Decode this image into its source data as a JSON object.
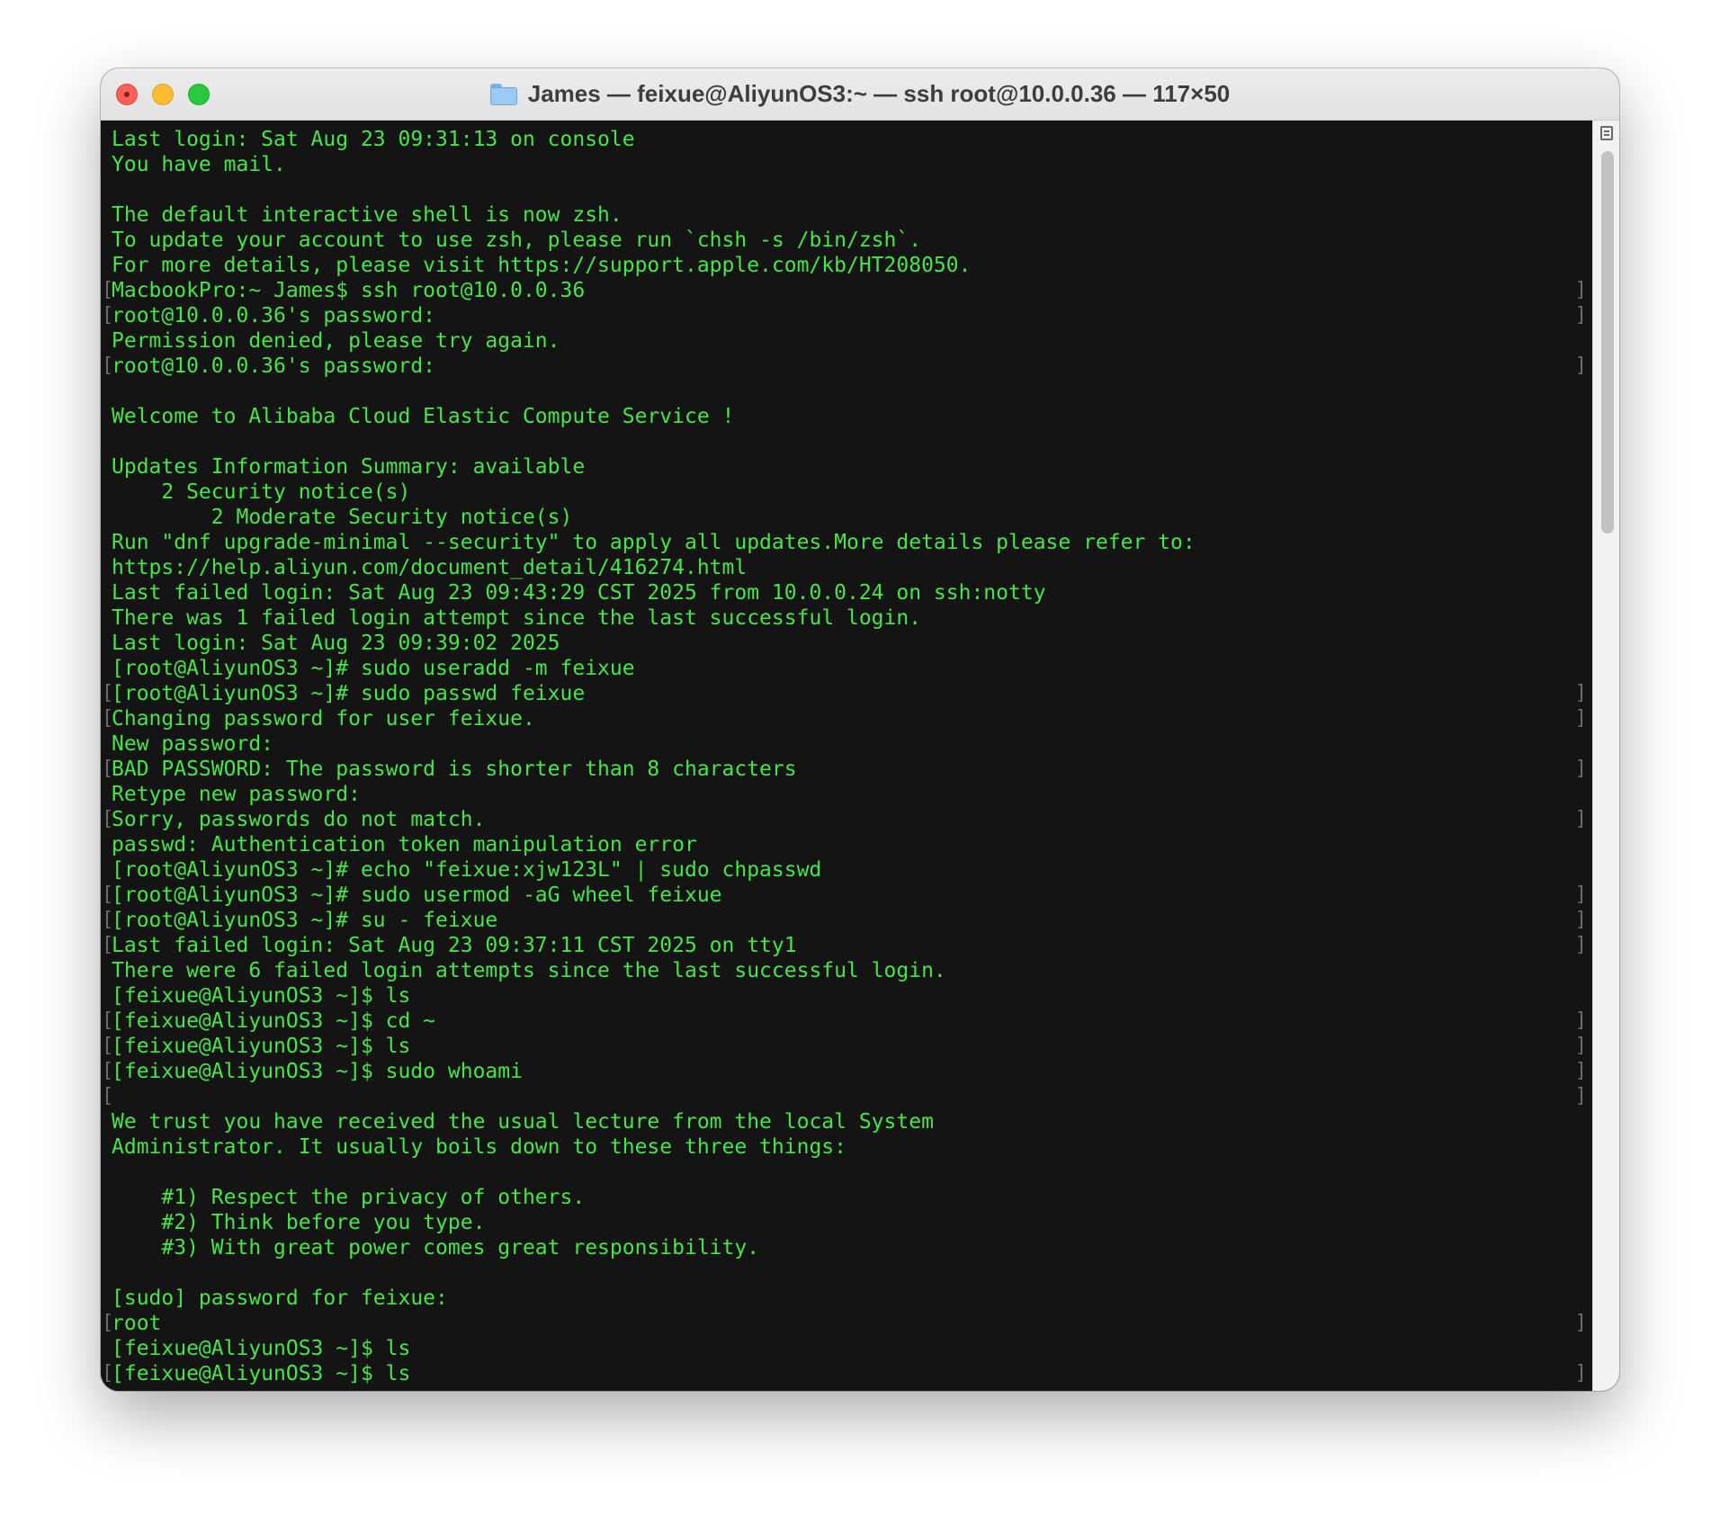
{
  "window": {
    "title": "James — feixue@AliyunOS3:~ — ssh root@10.0.0.36 — 117×50"
  },
  "icons": {
    "title": "folder-icon",
    "scroll_menu": "menu-icon"
  },
  "colors": {
    "terminal_background": "#141414",
    "terminal_text": "#46e646",
    "close": "#fe5f57",
    "minimize": "#febc2e",
    "zoom": "#28c840"
  },
  "scroll": {
    "position_fraction": 0.0,
    "visible_fraction": 0.31
  },
  "terminal": {
    "lines": [
      {
        "text": "Last login: Sat Aug 23 09:31:13 on console",
        "marked": false
      },
      {
        "text": "You have mail.",
        "marked": false
      },
      {
        "text": "",
        "marked": false
      },
      {
        "text": "The default interactive shell is now zsh.",
        "marked": false
      },
      {
        "text": "To update your account to use zsh, please run `chsh -s /bin/zsh`.",
        "marked": false
      },
      {
        "text": "For more details, please visit https://support.apple.com/kb/HT208050.",
        "marked": false
      },
      {
        "text": "MacbookPro:~ James$ ssh root@10.0.0.36",
        "marked": true
      },
      {
        "text": "root@10.0.0.36's password:",
        "marked": true
      },
      {
        "text": "Permission denied, please try again.",
        "marked": false
      },
      {
        "text": "root@10.0.0.36's password:",
        "marked": true
      },
      {
        "text": "",
        "marked": false
      },
      {
        "text": "Welcome to Alibaba Cloud Elastic Compute Service !",
        "marked": false
      },
      {
        "text": "",
        "marked": false
      },
      {
        "text": "Updates Information Summary: available",
        "marked": false
      },
      {
        "text": "    2 Security notice(s)",
        "marked": false
      },
      {
        "text": "        2 Moderate Security notice(s)",
        "marked": false
      },
      {
        "text": "Run \"dnf upgrade-minimal --security\" to apply all updates.More details please refer to:",
        "marked": false
      },
      {
        "text": "https://help.aliyun.com/document_detail/416274.html",
        "marked": false
      },
      {
        "text": "Last failed login: Sat Aug 23 09:43:29 CST 2025 from 10.0.0.24 on ssh:notty",
        "marked": false
      },
      {
        "text": "There was 1 failed login attempt since the last successful login.",
        "marked": false
      },
      {
        "text": "Last login: Sat Aug 23 09:39:02 2025",
        "marked": false
      },
      {
        "text": "[root@AliyunOS3 ~]# sudo useradd -m feixue",
        "marked": false
      },
      {
        "text": "[root@AliyunOS3 ~]# sudo passwd feixue",
        "marked": true
      },
      {
        "text": "Changing password for user feixue.",
        "marked": true
      },
      {
        "text": "New password:",
        "marked": false
      },
      {
        "text": "BAD PASSWORD: The password is shorter than 8 characters",
        "marked": true
      },
      {
        "text": "Retype new password:",
        "marked": false
      },
      {
        "text": "Sorry, passwords do not match.",
        "marked": true
      },
      {
        "text": "passwd: Authentication token manipulation error",
        "marked": false
      },
      {
        "text": "[root@AliyunOS3 ~]# echo \"feixue:xjw123L\" | sudo chpasswd",
        "marked": false
      },
      {
        "text": "[root@AliyunOS3 ~]# sudo usermod -aG wheel feixue",
        "marked": true
      },
      {
        "text": "[root@AliyunOS3 ~]# su - feixue",
        "marked": true
      },
      {
        "text": "Last failed login: Sat Aug 23 09:37:11 CST 2025 on tty1",
        "marked": true
      },
      {
        "text": "There were 6 failed login attempts since the last successful login.",
        "marked": false
      },
      {
        "text": "[feixue@AliyunOS3 ~]$ ls",
        "marked": false
      },
      {
        "text": "[feixue@AliyunOS3 ~]$ cd ~",
        "marked": true
      },
      {
        "text": "[feixue@AliyunOS3 ~]$ ls",
        "marked": true
      },
      {
        "text": "[feixue@AliyunOS3 ~]$ sudo whoami",
        "marked": true
      },
      {
        "text": "",
        "marked": true
      },
      {
        "text": "We trust you have received the usual lecture from the local System",
        "marked": false
      },
      {
        "text": "Administrator. It usually boils down to these three things:",
        "marked": false
      },
      {
        "text": "",
        "marked": false
      },
      {
        "text": "    #1) Respect the privacy of others.",
        "marked": false
      },
      {
        "text": "    #2) Think before you type.",
        "marked": false
      },
      {
        "text": "    #3) With great power comes great responsibility.",
        "marked": false
      },
      {
        "text": "",
        "marked": false
      },
      {
        "text": "[sudo] password for feixue:",
        "marked": false
      },
      {
        "text": "root",
        "marked": true
      },
      {
        "text": "[feixue@AliyunOS3 ~]$ ls",
        "marked": false
      },
      {
        "text": "[feixue@AliyunOS3 ~]$ ls",
        "marked": true
      }
    ]
  }
}
